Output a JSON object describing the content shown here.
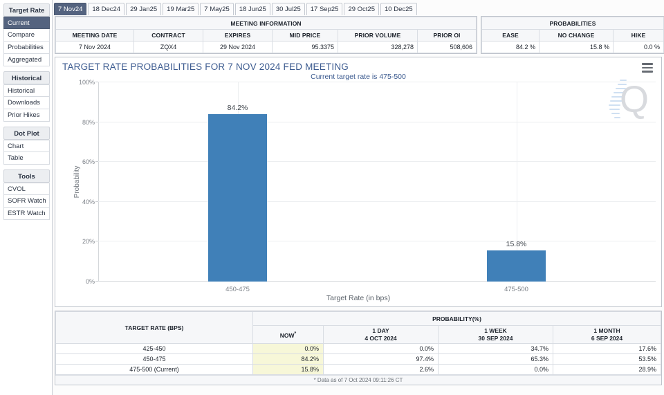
{
  "sidebar": {
    "groups": [
      {
        "header": "Target Rate",
        "items": [
          {
            "label": "Current",
            "active": true
          },
          {
            "label": "Compare",
            "active": false
          },
          {
            "label": "Probabilities",
            "active": false
          },
          {
            "label": "Aggregated",
            "active": false
          }
        ]
      },
      {
        "header": "Historical",
        "items": [
          {
            "label": "Historical",
            "active": false
          },
          {
            "label": "Downloads",
            "active": false
          },
          {
            "label": "Prior Hikes",
            "active": false
          }
        ]
      },
      {
        "header": "Dot Plot",
        "items": [
          {
            "label": "Chart",
            "active": false
          },
          {
            "label": "Table",
            "active": false
          }
        ]
      },
      {
        "header": "Tools",
        "items": [
          {
            "label": "CVOL",
            "active": false
          },
          {
            "label": "SOFR Watch",
            "active": false
          },
          {
            "label": "ESTR Watch",
            "active": false
          }
        ]
      }
    ]
  },
  "tabs": [
    {
      "label": "7 Nov24",
      "active": true
    },
    {
      "label": "18 Dec24",
      "active": false
    },
    {
      "label": "29 Jan25",
      "active": false
    },
    {
      "label": "19 Mar25",
      "active": false
    },
    {
      "label": "7 May25",
      "active": false
    },
    {
      "label": "18 Jun25",
      "active": false
    },
    {
      "label": "30 Jul25",
      "active": false
    },
    {
      "label": "17 Sep25",
      "active": false
    },
    {
      "label": "29 Oct25",
      "active": false
    },
    {
      "label": "10 Dec25",
      "active": false
    }
  ],
  "meeting_information": {
    "group_title": "MEETING INFORMATION",
    "columns": [
      "MEETING DATE",
      "CONTRACT",
      "EXPIRES",
      "MID PRICE",
      "PRIOR VOLUME",
      "PRIOR OI"
    ],
    "row": {
      "meeting_date": "7 Nov 2024",
      "contract": "ZQX4",
      "expires": "29 Nov 2024",
      "mid_price": "95.3375",
      "prior_volume": "328,278",
      "prior_oi": "508,606"
    }
  },
  "probabilities": {
    "group_title": "PROBABILITIES",
    "columns": [
      "EASE",
      "NO CHANGE",
      "HIKE"
    ],
    "row": {
      "ease": "84.2 %",
      "no_change": "15.8 %",
      "hike": "0.0 %"
    }
  },
  "chart": {
    "title": "TARGET RATE PROBABILITIES FOR 7 NOV 2024 FED MEETING",
    "subtitle": "Current target rate is 475-500",
    "menu_icon": "hamburger-menu-icon",
    "watermark": "Q"
  },
  "chart_data": {
    "type": "bar",
    "title": "TARGET RATE PROBABILITIES FOR 7 NOV 2024 FED MEETING",
    "subtitle": "Current target rate is 475-500",
    "categories": [
      "450-475",
      "475-500"
    ],
    "values": [
      84.2,
      15.8
    ],
    "data_labels": [
      "84.2%",
      "15.8%"
    ],
    "xlabel": "Target Rate (in bps)",
    "ylabel": "Probability",
    "ylim": [
      0,
      100
    ],
    "yticks": [
      0,
      20,
      40,
      60,
      80,
      100
    ],
    "ytick_labels": [
      "0%",
      "20%",
      "40%",
      "60%",
      "80%",
      "100%"
    ],
    "grid": true,
    "legend": false,
    "bar_color": "#4080b8"
  },
  "probability_table": {
    "rate_column_header": "TARGET RATE (BPS)",
    "group_header": "PROBABILITY(%)",
    "columns": [
      {
        "line1": "NOW",
        "line2": "",
        "footnote_marker": "*"
      },
      {
        "line1": "1 DAY",
        "line2": "4 OCT 2024",
        "footnote_marker": ""
      },
      {
        "line1": "1 WEEK",
        "line2": "30 SEP 2024",
        "footnote_marker": ""
      },
      {
        "line1": "1 MONTH",
        "line2": "6 SEP 2024",
        "footnote_marker": ""
      }
    ],
    "rows": [
      {
        "rate": "425-450",
        "now": "0.0%",
        "day1": "0.0%",
        "week1": "34.7%",
        "month1": "17.6%"
      },
      {
        "rate": "450-475",
        "now": "84.2%",
        "day1": "97.4%",
        "week1": "65.3%",
        "month1": "53.5%"
      },
      {
        "rate": "475-500 (Current)",
        "now": "15.8%",
        "day1": "2.6%",
        "week1": "0.0%",
        "month1": "28.9%"
      }
    ],
    "footnote": "* Data as of 7 Oct 2024 09:11:26 CT"
  },
  "colors": {
    "accent": "#54637f",
    "bar": "#4080b8",
    "highlight_cell": "#f7f7d8",
    "title_blue": "#3b5a8f"
  }
}
